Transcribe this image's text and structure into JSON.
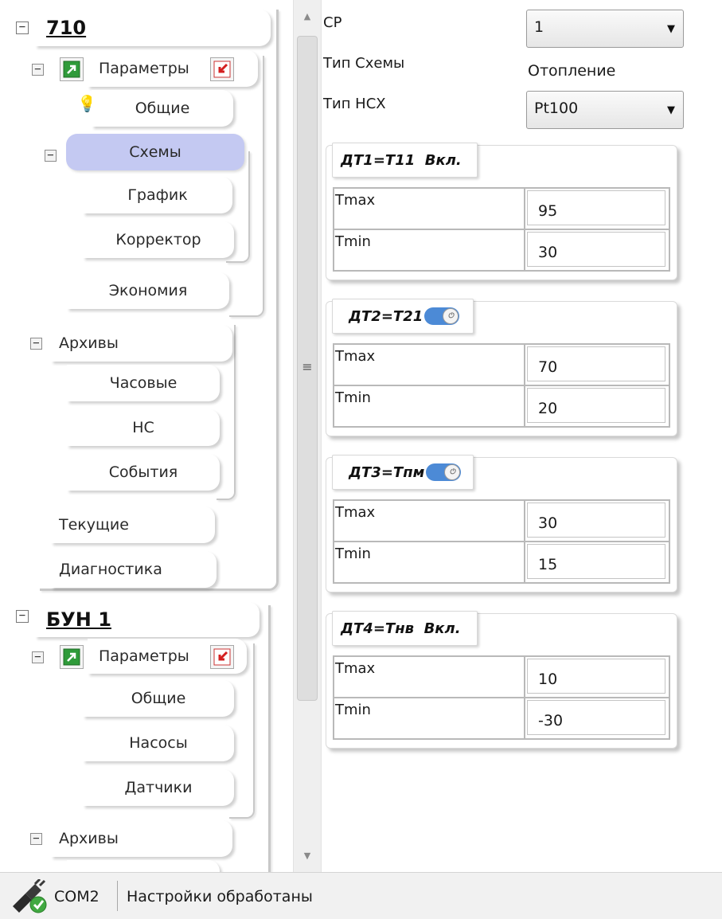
{
  "tree": {
    "device1": {
      "title": "710",
      "params": {
        "label": "Параметры",
        "children": [
          "Общие",
          "Схемы",
          "График",
          "Корректор",
          "Экономия"
        ]
      },
      "archives": {
        "label": "Архивы",
        "children": [
          "Часовые",
          "НС",
          "События"
        ]
      },
      "current": "Текущие",
      "diagnostics": "Диагностика"
    },
    "device2": {
      "title": "БУН 1",
      "params": {
        "label": "Параметры",
        "children": [
          "Общие",
          "Насосы",
          "Датчики"
        ]
      },
      "archives": {
        "label": "Архивы"
      }
    }
  },
  "panel": {
    "sp_label": "СР",
    "sp_value": "1",
    "scheme_type_label": "Тип Схемы",
    "scheme_type_value": "Отопление",
    "nsh_type_label": "Тип НСХ",
    "nsh_type_value": "Pt100"
  },
  "sensors": [
    {
      "title": "ДТ1=Т11",
      "state": "Вкл.",
      "tmax_label": "Tmax",
      "tmax": "95",
      "tmin_label": "Tmin",
      "tmin": "30"
    },
    {
      "title": "ДТ2=Т21",
      "tmax_label": "Tmax",
      "tmax": "70",
      "tmin_label": "Tmin",
      "tmin": "20"
    },
    {
      "title": "ДТ3=Тпм",
      "tmax_label": "Tmax",
      "tmax": "30",
      "tmin_label": "Tmin",
      "tmin": "15"
    },
    {
      "title": "ДТ4=Тнв",
      "state": "Вкл.",
      "tmax_label": "Tmax",
      "tmax": "10",
      "tmin_label": "Tmin",
      "tmin": "-30"
    }
  ],
  "status": {
    "port": "COM2",
    "message": "Настройки обработаны"
  },
  "colors": {
    "selected_node": "#c4c9f2",
    "toggle": "#4c8ad6"
  },
  "icons": [
    "expander-minus-icon",
    "params-open-icon",
    "params-upload-icon",
    "lightbulb-icon",
    "scroll-up-icon",
    "scroll-down-icon",
    "scroll-grip-icon",
    "combo-arrow-icon",
    "toggle-switch-icon",
    "connection-plug-icon"
  ]
}
